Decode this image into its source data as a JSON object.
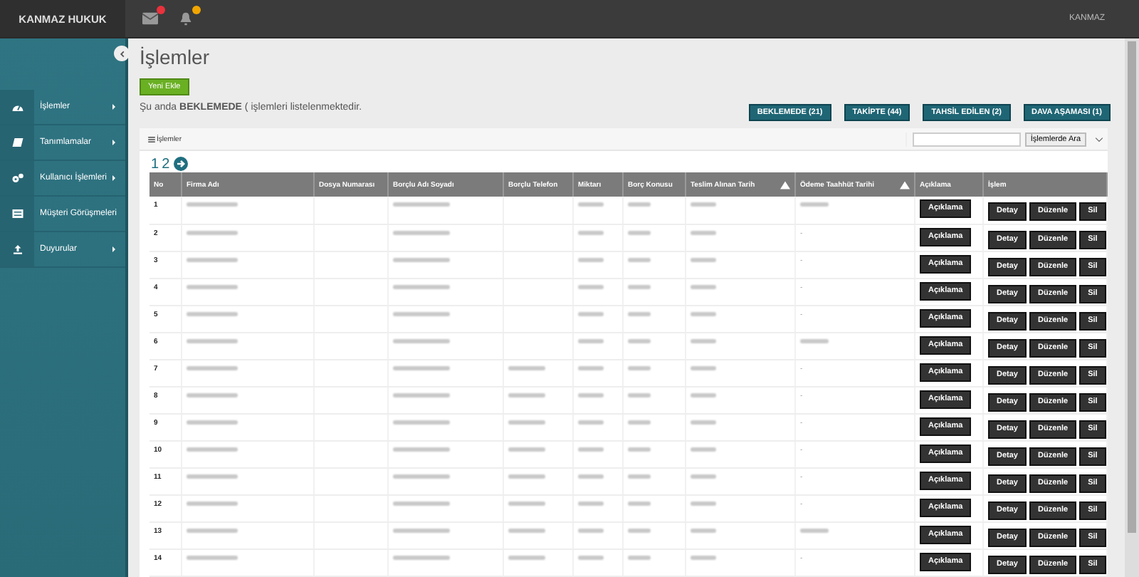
{
  "brand": "KANMAZ HUKUK",
  "user": {
    "name": "KANMAZ"
  },
  "notifications": [
    {
      "kind": "mail",
      "color": "#e8323c"
    },
    {
      "kind": "bell",
      "color": "#f0a500"
    }
  ],
  "sidebar": {
    "items": [
      {
        "label": "İşlemler",
        "has_submenu": true
      },
      {
        "label": "Tanımlamalar",
        "has_submenu": true
      },
      {
        "label": "Kullanıcı İşlemleri",
        "has_submenu": true
      },
      {
        "label": "Müşteri Görüşmeleri",
        "has_submenu": false
      },
      {
        "label": "Duyurular",
        "has_submenu": true
      }
    ]
  },
  "page": {
    "title": "İşlemler",
    "add_button": "Yeni Ekle",
    "status": "Şu anda **BEKLEMEDE** ( işlemleri listelenmektedir."
  },
  "filters": [
    {
      "label": "BEKLEMEDE (21)"
    },
    {
      "label": "TAKİPTE (44)"
    },
    {
      "label": "TAHSİL EDİLEN (2)"
    },
    {
      "label": "DAVA AŞAMASI (1)"
    }
  ],
  "panel": {
    "title": "İşlemler",
    "search_button": "İşlemlerde Ara"
  },
  "pagination": {
    "pages": [
      "1",
      "2"
    ]
  },
  "table": {
    "columns": [
      {
        "label": "No"
      },
      {
        "label": "Firma Adı"
      },
      {
        "label": "Dosya Numarası"
      },
      {
        "label": "Borçlu Adı Soyadı"
      },
      {
        "label": "Borçlu Telefon"
      },
      {
        "label": "Miktarı"
      },
      {
        "label": "Borç Konusu"
      },
      {
        "label": "Teslim Alınan Tarih",
        "sortable": true
      },
      {
        "label": "Ödeme Taahhüt Tarihi",
        "sortable": true
      },
      {
        "label": "Açıklama"
      },
      {
        "label": "İşlem"
      }
    ],
    "rows": [
      {
        "no": "1",
        "phone_shown": false,
        "payment_blurred": true,
        "buttons": [
          "Açıklama",
          "Detay",
          "Düzenle",
          "Sil"
        ]
      },
      {
        "no": "2",
        "phone_shown": false,
        "payment": "-",
        "buttons": [
          "Açıklama",
          "Detay",
          "Düzenle",
          "Sil"
        ]
      },
      {
        "no": "3",
        "phone_shown": false,
        "payment": "-",
        "buttons": [
          "Açıklama",
          "Detay",
          "Düzenle",
          "Sil"
        ]
      },
      {
        "no": "4",
        "phone_shown": false,
        "payment": "-",
        "buttons": [
          "Açıklama",
          "Detay",
          "Düzenle",
          "Sil"
        ]
      },
      {
        "no": "5",
        "phone_shown": false,
        "payment": "-",
        "buttons": [
          "Açıklama",
          "Detay",
          "Düzenle",
          "Sil"
        ]
      },
      {
        "no": "6",
        "phone_shown": false,
        "payment_blurred": true,
        "buttons": [
          "Açıklama",
          "Detay",
          "Düzenle",
          "Sil"
        ]
      },
      {
        "no": "7",
        "phone_shown": true,
        "payment": "-",
        "buttons": [
          "Açıklama",
          "Detay",
          "Düzenle",
          "Sil"
        ]
      },
      {
        "no": "8",
        "phone_shown": true,
        "payment": "-",
        "buttons": [
          "Açıklama",
          "Detay",
          "Düzenle",
          "Sil"
        ]
      },
      {
        "no": "9",
        "phone_shown": true,
        "payment": "-",
        "buttons": [
          "Açıklama",
          "Detay",
          "Düzenle",
          "Sil"
        ]
      },
      {
        "no": "10",
        "phone_shown": true,
        "payment": "-",
        "buttons": [
          "Açıklama",
          "Detay",
          "Düzenle",
          "Sil"
        ]
      },
      {
        "no": "11",
        "phone_shown": true,
        "payment": "-",
        "buttons": [
          "Açıklama",
          "Detay",
          "Düzenle",
          "Sil"
        ]
      },
      {
        "no": "12",
        "phone_shown": true,
        "payment": "-",
        "buttons": [
          "Açıklama",
          "Detay",
          "Düzenle",
          "Sil"
        ]
      },
      {
        "no": "13",
        "phone_shown": true,
        "payment_blurred": true,
        "buttons": [
          "Açıklama",
          "Detay",
          "Düzenle",
          "Sil"
        ]
      },
      {
        "no": "14",
        "phone_shown": true,
        "payment": "-",
        "buttons": [
          "Açıklama",
          "Detay",
          "Düzenle",
          "Sil"
        ]
      }
    ]
  }
}
